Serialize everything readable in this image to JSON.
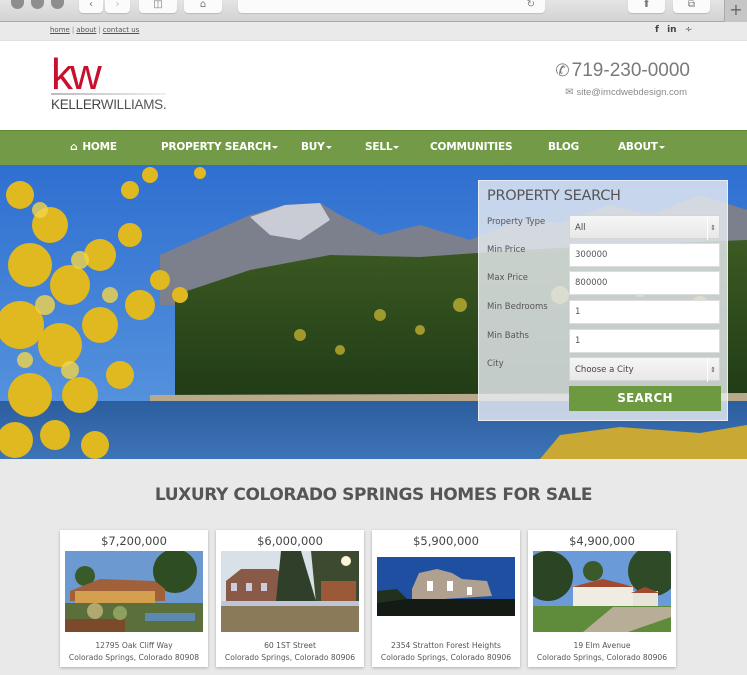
{
  "browser": {
    "back_icon": "chevron-left",
    "forward_icon": "chevron-right",
    "sidebar_icon": "sidebar",
    "home_icon": "home",
    "reload_icon": "reload",
    "share_icon": "share",
    "tabs_icon": "tabs",
    "new_tab_icon": "plus"
  },
  "topbar": {
    "links": [
      "home",
      "about",
      "contact us"
    ],
    "social": {
      "facebook": "f",
      "linkedin": "in",
      "rss": "⌖"
    }
  },
  "header": {
    "logo_mark": "kw",
    "logo_brand_bold": "KELLER",
    "logo_brand_rest": "WILLIAMS.",
    "phone": "719-230-0000",
    "email": "site@imcdwebdesign.com",
    "brand_color": "#c8102e"
  },
  "nav": {
    "color": "#739b47",
    "items": [
      {
        "label": "HOME",
        "icon": "home",
        "dropdown": false
      },
      {
        "label": "PROPERTY SEARCH",
        "dropdown": true
      },
      {
        "label": "BUY",
        "dropdown": true
      },
      {
        "label": "SELL",
        "dropdown": true
      },
      {
        "label": "COMMUNITIES",
        "dropdown": false
      },
      {
        "label": "BLOG",
        "dropdown": false
      },
      {
        "label": "ABOUT",
        "dropdown": true
      }
    ]
  },
  "search": {
    "title": "PROPERTY SEARCH",
    "fields": {
      "property_type": {
        "label": "Property Type",
        "value": "All"
      },
      "min_price": {
        "label": "Min Price",
        "value": "300000"
      },
      "max_price": {
        "label": "Max Price",
        "value": "800000"
      },
      "min_bedrooms": {
        "label": "Min Bedrooms",
        "value": "1"
      },
      "min_baths": {
        "label": "Min Baths",
        "value": "1"
      },
      "city": {
        "label": "City",
        "value": "Choose a City"
      }
    },
    "button": "SEARCH"
  },
  "listings": {
    "title": "LUXURY COLORADO SPRINGS HOMES FOR SALE",
    "items": [
      {
        "price": "$7,200,000",
        "street": "12795 Oak Cliff Way",
        "city": "Colorado Springs, Colorado 80908"
      },
      {
        "price": "$6,000,000",
        "street": "60 1ST Street",
        "city": "Colorado Springs, Colorado 80906"
      },
      {
        "price": "$5,900,000",
        "street": "2354 Stratton Forest Heights",
        "city": "Colorado Springs, Colorado 80906"
      },
      {
        "price": "$4,900,000",
        "street": "19 Elm Avenue",
        "city": "Colorado Springs, Colorado 80906"
      }
    ]
  }
}
